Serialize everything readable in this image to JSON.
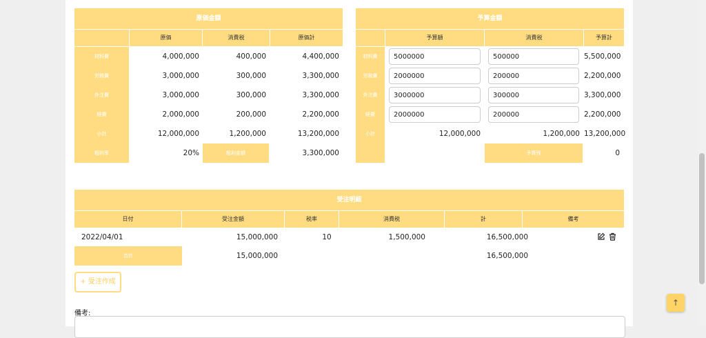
{
  "cost": {
    "title": "原価金額",
    "columns": [
      "原価",
      "消費税",
      "原価計"
    ],
    "rows": [
      {
        "label": "材料費",
        "cost": "4,000,000",
        "tax": "400,000",
        "total": "4,400,000"
      },
      {
        "label": "労務費",
        "cost": "3,000,000",
        "tax": "300,000",
        "total": "3,300,000"
      },
      {
        "label": "外注費",
        "cost": "3,000,000",
        "tax": "300,000",
        "total": "3,300,000"
      },
      {
        "label": "経費",
        "cost": "2,000,000",
        "tax": "200,000",
        "total": "2,200,000"
      },
      {
        "label": "小計",
        "cost": "12,000,000",
        "tax": "1,200,000",
        "total": "13,200,000"
      }
    ],
    "profit_rate_label": "粗利率",
    "profit_rate": "20%",
    "profit_amount_label": "粗利金額",
    "profit_amount": "3,300,000"
  },
  "budget": {
    "title": "予算金額",
    "columns": [
      "予算額",
      "消費税",
      "予算計"
    ],
    "rows": [
      {
        "label": "材料費",
        "amount": "5000000",
        "tax": "500000",
        "total": "5,500,000"
      },
      {
        "label": "労務費",
        "amount": "2000000",
        "tax": "200000",
        "total": "2,200,000"
      },
      {
        "label": "外注費",
        "amount": "3000000",
        "tax": "300000",
        "total": "3,300,000"
      },
      {
        "label": "経費",
        "amount": "2000000",
        "tax": "200000",
        "total": "2,200,000"
      }
    ],
    "subtotal": {
      "label": "小計",
      "amount": "12,000,000",
      "tax": "1,200,000",
      "total": "13,200,000"
    },
    "remain_label": "予算残",
    "remain": "0"
  },
  "orders": {
    "title": "受注明細",
    "columns": [
      "日付",
      "受注金額",
      "税率",
      "消費税",
      "計",
      "備考"
    ],
    "rows": [
      {
        "date": "2022/04/01",
        "amount": "15,000,000",
        "rate": "10",
        "tax": "1,500,000",
        "total": "16,500,000"
      }
    ],
    "sum_label": "合計",
    "sum_amount": "15,000,000",
    "sum_total": "16,500,000"
  },
  "add_order_label": "+ 受注作成",
  "notes_label": "備考:",
  "colors": {
    "accent": "#ffdc82"
  }
}
